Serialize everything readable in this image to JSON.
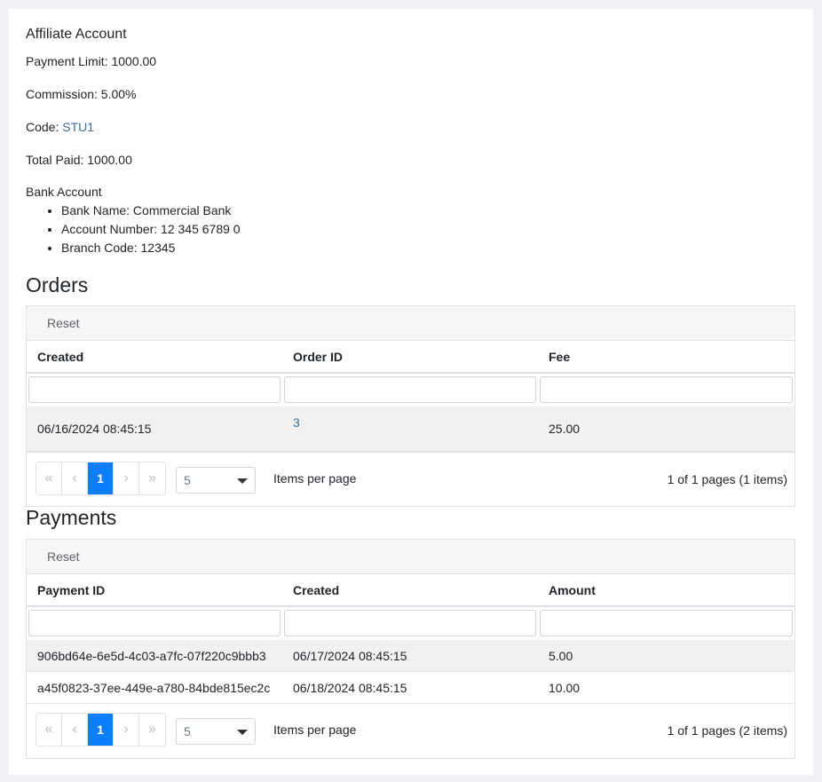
{
  "affiliate": {
    "title": "Affiliate Account",
    "payment_limit_label": "Payment Limit:",
    "payment_limit": "1000.00",
    "commission_label": "Commission:",
    "commission": "5.00%",
    "code_label": "Code:",
    "code": "STU1",
    "total_paid_label": "Total Paid:",
    "total_paid": "1000.00"
  },
  "bank": {
    "title": "Bank Account",
    "items": [
      "Bank Name: Commercial Bank",
      "Account Number: 12 345 6789 0",
      "Branch Code: 12345"
    ]
  },
  "orders": {
    "title": "Orders",
    "reset_label": "Reset",
    "columns": [
      "Created",
      "Order ID",
      "Fee"
    ],
    "rows": [
      [
        "06/16/2024 08:45:15",
        "3",
        "25.00"
      ]
    ],
    "pager": {
      "first": "«",
      "prev": "‹",
      "page": "1",
      "next": "›",
      "last": "»",
      "page_size": "5",
      "items_per_page": "Items per page",
      "info": "1 of 1 pages (1 items)"
    }
  },
  "payments": {
    "title": "Payments",
    "reset_label": "Reset",
    "columns": [
      "Payment ID",
      "Created",
      "Amount"
    ],
    "rows": [
      [
        "906bd64e-6e5d-4c03-a7fc-07f220c9bbb3",
        "06/17/2024 08:45:15",
        "5.00"
      ],
      [
        "a45f0823-37ee-449e-a780-84bde815ec2c",
        "06/18/2024 08:45:15",
        "10.00"
      ]
    ],
    "pager": {
      "first": "«",
      "prev": "‹",
      "page": "1",
      "next": "›",
      "last": "»",
      "page_size": "5",
      "items_per_page": "Items per page",
      "info": "1 of 1 pages (2 items)"
    }
  },
  "colors": {
    "accent": "#0d7ffe",
    "link": "#3f6f95",
    "page_bg": "#f0f2f5"
  }
}
